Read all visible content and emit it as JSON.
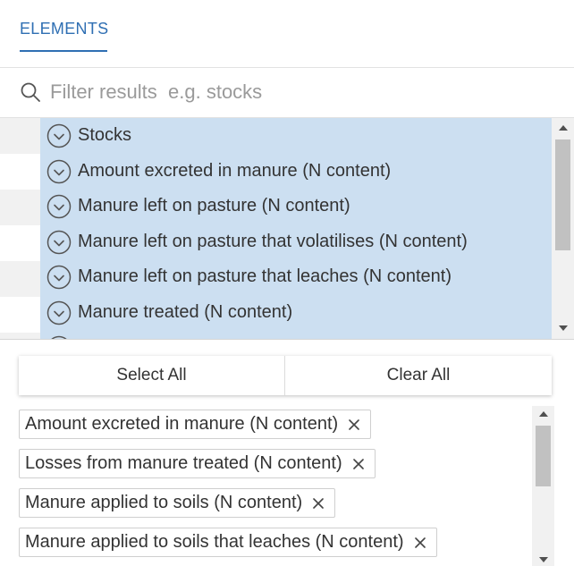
{
  "tabs": [
    {
      "label": "ELEMENTS",
      "active": true
    }
  ],
  "search": {
    "placeholder": "Filter results  e.g. stocks",
    "value": ""
  },
  "elements": {
    "items": [
      {
        "label": "Stocks",
        "selected": true
      },
      {
        "label": "Amount excreted in manure (N content)",
        "selected": true
      },
      {
        "label": "Manure left on pasture (N content)",
        "selected": true
      },
      {
        "label": "Manure left on pasture that volatilises (N content)",
        "selected": true
      },
      {
        "label": "Manure left on pasture that leaches (N content)",
        "selected": true
      },
      {
        "label": "Manure treated (N content)",
        "selected": true
      },
      {
        "label": "",
        "selected": true
      }
    ]
  },
  "actions": {
    "select_all": "Select All",
    "clear_all": "Clear All"
  },
  "selected_chips": [
    {
      "label": "Amount excreted in manure (N content)"
    },
    {
      "label": "Losses from manure treated (N content)"
    },
    {
      "label": "Manure applied to soils (N content)"
    },
    {
      "label": "Manure applied to soils that leaches (N content)"
    }
  ],
  "colors": {
    "accent": "#2f6fb3",
    "selected_bg": "#ccdff1",
    "stripe": "#f1f1f1",
    "scroll_thumb": "#c1c1c1"
  },
  "icons": {
    "search": "search-icon",
    "item_check": "check-circle-icon",
    "chip_remove": "close-icon",
    "scroll_up": "arrow-up-icon",
    "scroll_down": "arrow-down-icon"
  }
}
